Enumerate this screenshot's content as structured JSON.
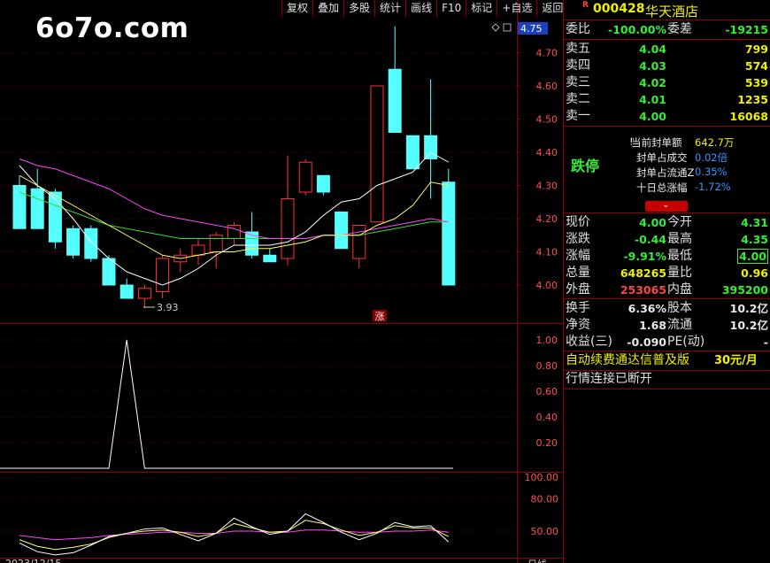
{
  "toolbar": [
    "复权",
    "叠加",
    "多股",
    "统计",
    "画线",
    "F10",
    "标记",
    "+自选",
    "返回"
  ],
  "logo": "6o7o.com",
  "chart": {
    "price_labels": [
      "4.75",
      "4.70",
      "4.60",
      "4.50",
      "4.40",
      "4.30",
      "4.20",
      "4.10",
      "4.00"
    ],
    "low_marker": "3.93",
    "zhang_badge": "涨",
    "vol_labels": [
      "1.00",
      "0.80",
      "0.60",
      "0.40",
      "0.20"
    ],
    "osc_labels": [
      "100.00",
      "80.00",
      "50.00"
    ],
    "bottom_date": "2023/12/15",
    "bottom_right": "日线",
    "colors": {
      "up": "#ff3333",
      "down": "#54ffff",
      "ma5": "#ffffff",
      "ma10": "#ffff66",
      "ma20": "#ff44ff",
      "ma60": "#33dd33",
      "axis": "#8a0000"
    }
  },
  "chart_data": {
    "type": "candlestick",
    "ohlc": [
      {
        "o": 4.3,
        "h": 4.33,
        "l": 4.18,
        "c": 4.17
      },
      {
        "o": 4.29,
        "h": 4.35,
        "l": 4.17,
        "c": 4.17
      },
      {
        "o": 4.28,
        "h": 4.29,
        "l": 4.11,
        "c": 4.13
      },
      {
        "o": 4.17,
        "h": 4.18,
        "l": 4.08,
        "c": 4.09
      },
      {
        "o": 4.17,
        "h": 4.18,
        "l": 4.07,
        "c": 4.08
      },
      {
        "o": 4.08,
        "h": 4.09,
        "l": 4.0,
        "c": 4.0
      },
      {
        "o": 4.0,
        "h": 4.02,
        "l": 3.96,
        "c": 3.96
      },
      {
        "o": 3.96,
        "h": 4.0,
        "l": 3.93,
        "c": 3.99
      },
      {
        "o": 3.98,
        "h": 4.09,
        "l": 3.96,
        "c": 4.08
      },
      {
        "o": 4.07,
        "h": 4.11,
        "l": 4.04,
        "c": 4.09
      },
      {
        "o": 4.09,
        "h": 4.14,
        "l": 4.06,
        "c": 4.12
      },
      {
        "o": 4.1,
        "h": 4.16,
        "l": 4.05,
        "c": 4.15
      },
      {
        "o": 4.14,
        "h": 4.19,
        "l": 4.12,
        "c": 4.18
      },
      {
        "o": 4.16,
        "h": 4.22,
        "l": 4.08,
        "c": 4.09
      },
      {
        "o": 4.09,
        "h": 4.11,
        "l": 4.07,
        "c": 4.07
      },
      {
        "o": 4.08,
        "h": 4.39,
        "l": 4.06,
        "c": 4.26
      },
      {
        "o": 4.28,
        "h": 4.38,
        "l": 4.27,
        "c": 4.37
      },
      {
        "o": 4.33,
        "h": 4.33,
        "l": 4.27,
        "c": 4.28
      },
      {
        "o": 4.22,
        "h": 4.22,
        "l": 4.11,
        "c": 4.11
      },
      {
        "o": 4.08,
        "h": 4.18,
        "l": 4.05,
        "c": 4.18
      },
      {
        "o": 4.19,
        "h": 4.55,
        "l": 4.19,
        "c": 4.6
      },
      {
        "o": 4.65,
        "h": 4.78,
        "l": 4.46,
        "c": 4.46
      },
      {
        "o": 4.45,
        "h": 4.45,
        "l": 4.35,
        "c": 4.35
      },
      {
        "o": 4.45,
        "h": 4.62,
        "l": 4.26,
        "c": 4.38
      },
      {
        "o": 4.31,
        "h": 4.35,
        "l": 4.0,
        "c": 4.0
      }
    ],
    "ma5": [
      4.36,
      4.3,
      4.26,
      4.2,
      4.13,
      4.08,
      4.04,
      4.02,
      4.0,
      4.02,
      4.05,
      4.09,
      4.12,
      4.12,
      4.12,
      4.13,
      4.16,
      4.21,
      4.25,
      4.26,
      4.3,
      4.32,
      4.34,
      4.4,
      4.37
    ],
    "ma10": [
      4.33,
      4.3,
      4.27,
      4.24,
      4.21,
      4.18,
      4.15,
      4.12,
      4.09,
      4.08,
      4.09,
      4.1,
      4.1,
      4.11,
      4.11,
      4.12,
      4.13,
      4.15,
      4.15,
      4.15,
      4.18,
      4.2,
      4.24,
      4.31,
      4.3
    ],
    "ma20": [
      4.38,
      4.36,
      4.35,
      4.33,
      4.31,
      4.29,
      4.26,
      4.23,
      4.21,
      4.2,
      4.19,
      4.18,
      4.17,
      4.15,
      4.14,
      4.14,
      4.14,
      4.15,
      4.15,
      4.16,
      4.17,
      4.18,
      4.19,
      4.2,
      4.19
    ],
    "ma60": [
      4.28,
      4.26,
      4.24,
      4.22,
      4.2,
      4.18,
      4.17,
      4.16,
      4.15,
      4.14,
      4.14,
      4.14,
      4.14,
      4.14,
      4.14,
      4.14,
      4.14,
      4.15,
      4.15,
      4.15,
      4.16,
      4.17,
      4.18,
      4.19,
      4.19
    ],
    "volume_indicator": [
      0,
      0,
      0,
      0,
      0,
      0,
      1,
      0,
      0,
      0,
      0,
      0,
      0,
      0,
      0,
      0,
      0,
      0,
      0,
      0,
      0,
      0,
      0,
      0,
      0
    ],
    "osc_white": [
      39,
      31,
      28,
      30,
      37,
      45,
      48,
      52,
      53,
      47,
      41,
      48,
      62,
      54,
      47,
      50,
      66,
      58,
      49,
      42,
      48,
      58,
      54,
      55,
      40
    ],
    "osc_yellow": [
      42,
      36,
      33,
      35,
      38,
      44,
      48,
      50,
      51,
      49,
      45,
      48,
      57,
      53,
      49,
      50,
      60,
      57,
      51,
      46,
      49,
      55,
      53,
      53,
      45
    ],
    "osc_magenta": [
      46,
      44,
      42,
      43,
      44,
      46,
      47,
      48,
      49,
      49,
      48,
      48,
      50,
      50,
      49,
      49,
      51,
      51,
      50,
      49,
      49,
      50,
      50,
      51,
      49
    ]
  },
  "panel": {
    "code": "000428",
    "name": "华天酒店",
    "r_mark": "R",
    "weibi_label": "委比",
    "weibi": "-100.00%",
    "weicha_label": "委差",
    "weicha": "-19215",
    "asks": [
      {
        "label": "卖五",
        "price": "4.04",
        "vol": "799"
      },
      {
        "label": "卖四",
        "price": "4.03",
        "vol": "574"
      },
      {
        "label": "卖三",
        "price": "4.02",
        "vol": "539"
      },
      {
        "label": "卖二",
        "price": "4.01",
        "vol": "1235"
      },
      {
        "label": "卖一",
        "price": "4.00",
        "vol": "16068"
      }
    ],
    "limit_status": "跌停",
    "seal": [
      {
        "label": "当前封单额",
        "value": "642.7万"
      },
      {
        "label": "封单占成交",
        "value": "0.02倍"
      },
      {
        "label": "封单占流通Z",
        "value": "0.35%"
      },
      {
        "label": "十日总涨幅",
        "value": "-1.72%"
      }
    ],
    "quotes": [
      {
        "l1": "现价",
        "v1": "4.00",
        "l2": "今开",
        "v2": "4.31",
        "c1": "green",
        "c2": "green"
      },
      {
        "l1": "涨跌",
        "v1": "-0.44",
        "l2": "最高",
        "v2": "4.35",
        "c1": "green",
        "c2": "green"
      },
      {
        "l1": "涨幅",
        "v1": "-9.91%",
        "l2": "最低",
        "v2": "4.00",
        "c1": "green",
        "c2": "green"
      },
      {
        "l1": "总量",
        "v1": "648265",
        "l2": "量比",
        "v2": "0.96",
        "c1": "yellow",
        "c2": "yellow"
      },
      {
        "l1": "外盘",
        "v1": "253065",
        "l2": "内盘",
        "v2": "395200",
        "c1": "red",
        "c2": "green"
      }
    ],
    "stats": [
      {
        "l1": "换手",
        "v1": "6.36%",
        "l2": "股本",
        "v2": "10.2亿"
      },
      {
        "l1": "净资",
        "v1": "1.68",
        "l2": "流通",
        "v2": "10.2亿"
      },
      {
        "l1": "收益(三)",
        "v1": "-0.090",
        "l2": "PE(动)",
        "v2": "-"
      }
    ],
    "promo": "自动续费通达信普及版",
    "promo_price": "30元/月",
    "conn_status": "行情连接已断开"
  }
}
